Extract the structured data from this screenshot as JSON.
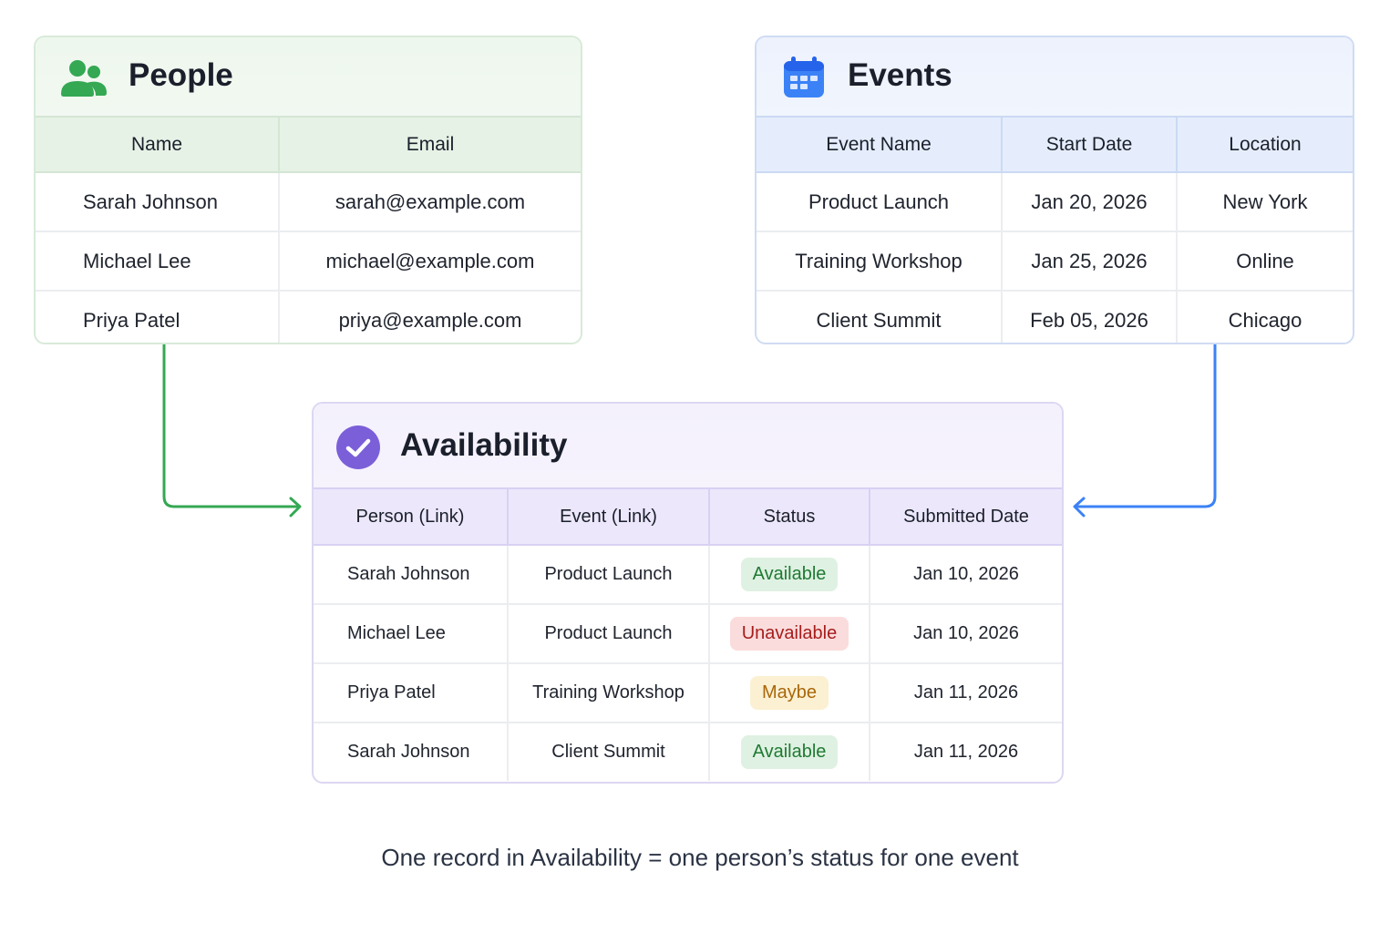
{
  "people": {
    "title": "People",
    "icon": "people-icon",
    "accent": "#34a853",
    "columns": [
      "Name",
      "Email"
    ],
    "rows": [
      [
        "Sarah Johnson",
        "sarah@example.com"
      ],
      [
        "Michael Lee",
        "michael@example.com"
      ],
      [
        "Priya Patel",
        "priya@example.com"
      ]
    ]
  },
  "events": {
    "title": "Events",
    "icon": "calendar-icon",
    "accent": "#3b82f6",
    "columns": [
      "Event Name",
      "Start Date",
      "Location"
    ],
    "rows": [
      [
        "Product Launch",
        "Jan 20, 2026",
        "New York"
      ],
      [
        "Training Workshop",
        "Jan 25, 2026",
        "Online"
      ],
      [
        "Client Summit",
        "Feb 05, 2026",
        "Chicago"
      ]
    ]
  },
  "availability": {
    "title": "Availability",
    "icon": "check-circle-icon",
    "accent": "#7b5fd9",
    "columns": [
      "Person (Link)",
      "Event (Link)",
      "Status",
      "Submitted Date"
    ],
    "rows": [
      [
        "Sarah Johnson",
        "Product Launch",
        "Available",
        "Jan 10, 2026"
      ],
      [
        "Michael Lee",
        "Product Launch",
        "Unavailable",
        "Jan 10, 2026"
      ],
      [
        "Priya Patel",
        "Training Workshop",
        "Maybe",
        "Jan 11, 2026"
      ],
      [
        "Sarah Johnson",
        "Client Summit",
        "Available",
        "Jan 11, 2026"
      ]
    ],
    "status_colors": {
      "Available": "#1f7a33",
      "Unavailable": "#a61d1d",
      "Maybe": "#a8670a"
    }
  },
  "connectors": {
    "people_to_availability_color": "#34a853",
    "events_to_availability_color": "#3b82f6"
  },
  "caption": "One record in Availability = one person’s status for one event"
}
